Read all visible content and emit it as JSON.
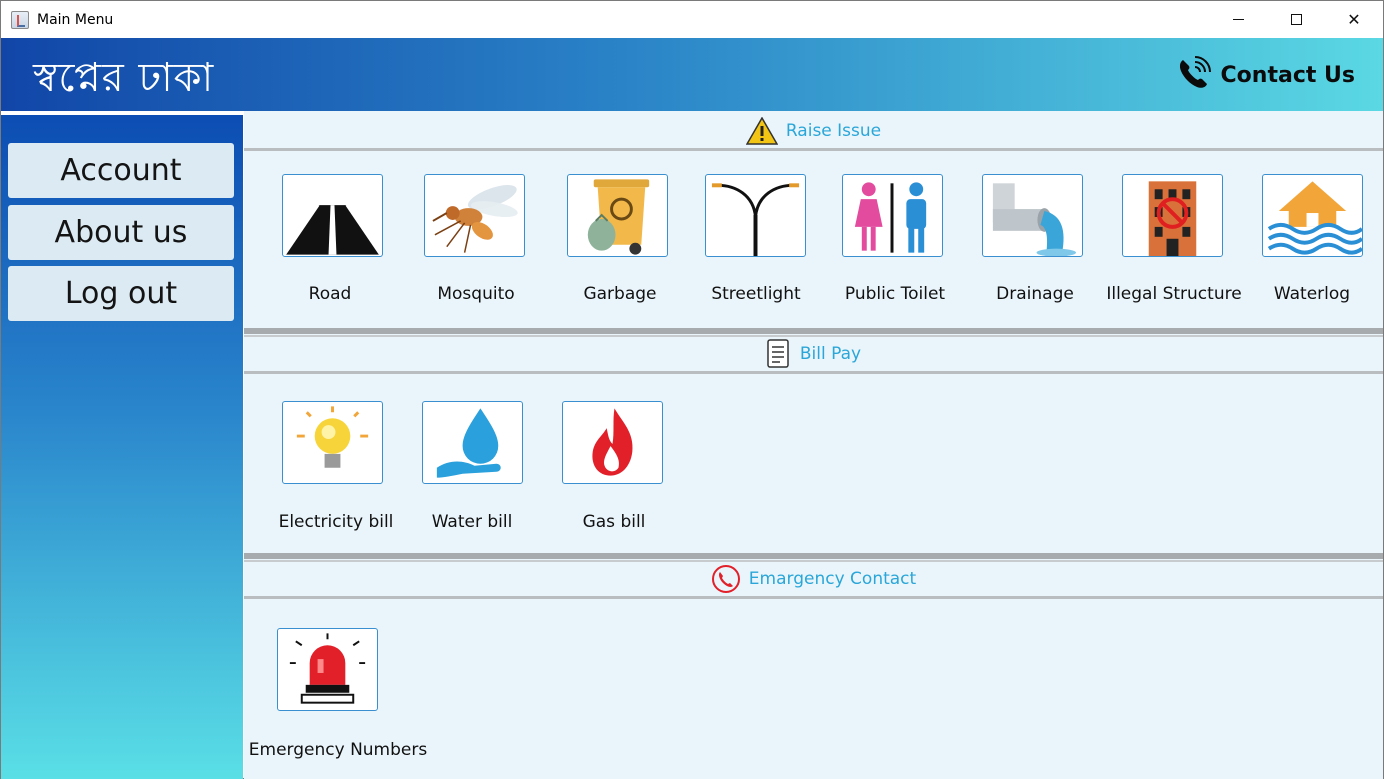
{
  "window": {
    "title": "Main Menu"
  },
  "header": {
    "logo": "স্বপ্নের ঢাকা",
    "contact": "Contact Us"
  },
  "sidebar": {
    "items": [
      {
        "label": "Account"
      },
      {
        "label": "About us"
      },
      {
        "label": "Log out"
      }
    ]
  },
  "sections": {
    "raise_issue": {
      "title": "Raise Issue",
      "items": [
        {
          "label": "Road",
          "icon": "road-icon"
        },
        {
          "label": "Mosquito",
          "icon": "mosquito-icon"
        },
        {
          "label": "Garbage",
          "icon": "garbage-icon"
        },
        {
          "label": "Streetlight",
          "icon": "streetlight-icon"
        },
        {
          "label": "Public Toilet",
          "icon": "public-toilet-icon"
        },
        {
          "label": "Drainage",
          "icon": "drainage-icon"
        },
        {
          "label": "Illegal Structure",
          "icon": "illegal-structure-icon"
        },
        {
          "label": "Waterlog",
          "icon": "waterlog-icon"
        }
      ]
    },
    "bill_pay": {
      "title": "Bill Pay",
      "items": [
        {
          "label": "Electricity bill",
          "icon": "lightbulb-icon"
        },
        {
          "label": "Water bill",
          "icon": "water-drop-icon"
        },
        {
          "label": "Gas bill",
          "icon": "flame-icon"
        }
      ]
    },
    "emergency": {
      "title": "Emargency Contact",
      "items": [
        {
          "label": "Emergency Numbers",
          "icon": "siren-icon"
        }
      ]
    }
  },
  "colors": {
    "header_start": "#1146a8",
    "header_end": "#5ad8e3",
    "section_title": "#2aa6d8",
    "tile_border": "#3a8fd0",
    "content_bg": "#eaf5fb"
  }
}
